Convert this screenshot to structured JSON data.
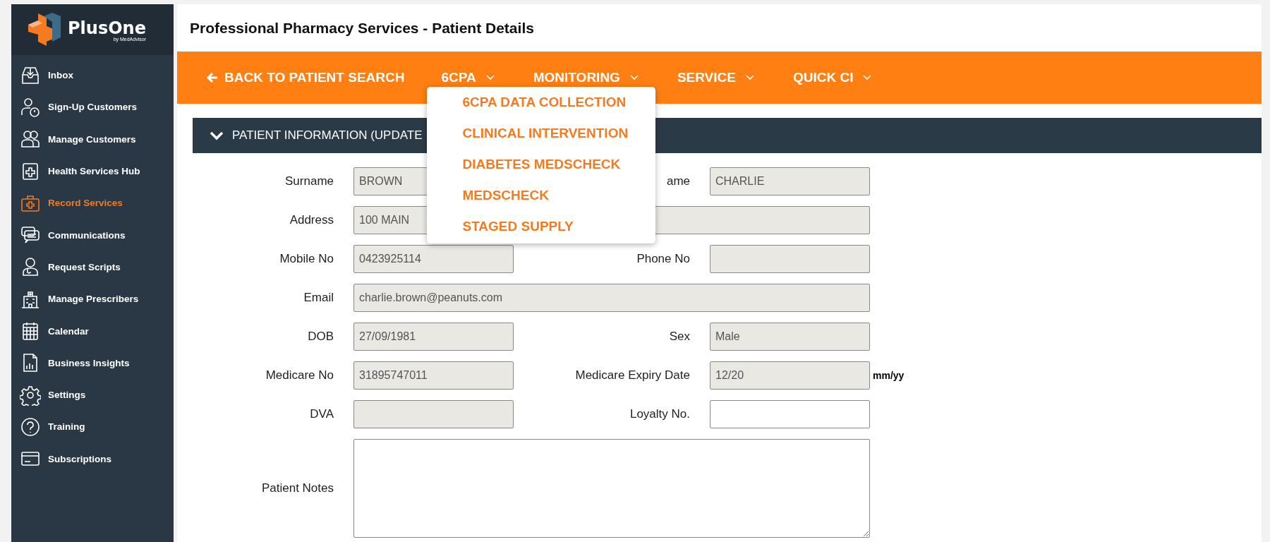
{
  "logo": {
    "name": "PlusOne",
    "tagline": "by MedAdvisor"
  },
  "sidebar": {
    "items": [
      {
        "label": "Inbox",
        "selected": false
      },
      {
        "label": "Sign-Up Customers",
        "selected": false
      },
      {
        "label": "Manage Customers",
        "selected": false
      },
      {
        "label": "Health Services Hub",
        "selected": false
      },
      {
        "label": "Record Services",
        "selected": true
      },
      {
        "label": "Communications",
        "selected": false
      },
      {
        "label": "Request Scripts",
        "selected": false
      },
      {
        "label": "Manage Prescribers",
        "selected": false
      },
      {
        "label": "Calendar",
        "selected": false
      },
      {
        "label": "Business Insights",
        "selected": false
      },
      {
        "label": "Settings",
        "selected": false
      },
      {
        "label": "Training",
        "selected": false
      },
      {
        "label": "Subscriptions",
        "selected": false
      }
    ]
  },
  "page_title": "Professional Pharmacy Services - Patient Details",
  "nav": {
    "back": "BACK TO PATIENT SEARCH",
    "menus": [
      {
        "label": "6CPA",
        "dropdown": [
          "6CPA DATA COLLECTION",
          "CLINICAL INTERVENTION",
          "DIABETES MEDSCHECK",
          "MEDSCHECK",
          "STAGED SUPPLY"
        ]
      },
      {
        "label": "MONITORING"
      },
      {
        "label": "SERVICE"
      },
      {
        "label": "QUICK CI"
      }
    ]
  },
  "panel": {
    "title": "PATIENT INFORMATION (UPDATE",
    "expanded": true
  },
  "form": {
    "fields": [
      {
        "label": "Surname",
        "value": "BROWN",
        "kind": "short",
        "disabled": true
      },
      {
        "label": "ame",
        "value": "CHARLIE",
        "kind": "short",
        "disabled": true
      },
      {
        "label": "Address",
        "value": "100 MAIN",
        "kind": "wide",
        "disabled": true
      },
      {
        "label": "Mobile No",
        "value": "0423925114",
        "kind": "short",
        "disabled": true
      },
      {
        "label": "Phone No",
        "kind": "short",
        "disabled": true
      },
      {
        "label": "Email",
        "value": "charlie.brown@peanuts.com",
        "kind": "wide",
        "disabled": true
      },
      {
        "label": "DOB",
        "value": "27/09/1981",
        "kind": "short",
        "disabled": true
      },
      {
        "label": "Sex",
        "value": "Male",
        "kind": "short",
        "disabled": true
      },
      {
        "label": "Medicare No",
        "value": "31895747011",
        "kind": "short",
        "disabled": true
      },
      {
        "label": "Medicare Expiry Date",
        "value": "12/20",
        "kind": "short",
        "disabled": true,
        "unit": "mm/yy"
      },
      {
        "label": "DVA",
        "kind": "short",
        "disabled": true
      },
      {
        "label": "Loyalty No.",
        "kind": "short",
        "disabled": false
      },
      {
        "label": "Patient Notes",
        "kind": "notes",
        "disabled": false
      }
    ]
  }
}
